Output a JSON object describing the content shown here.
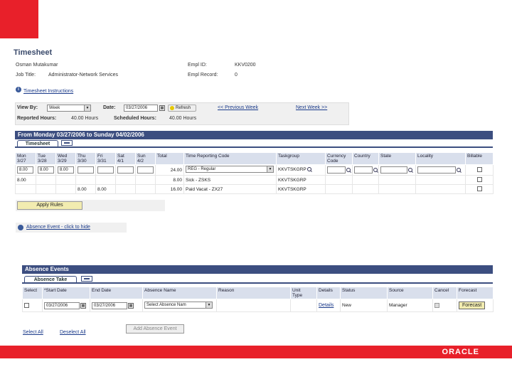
{
  "page": {
    "title": "Timesheet",
    "employee_name": "Osman Mutakumar",
    "job_title_label": "Job Title:",
    "job_title_value": "Administrator-Network Services",
    "empl_id_label": "Empl ID:",
    "empl_id_value": "KKV0200",
    "empl_rcd_label": "Empl Record:",
    "empl_rcd_value": "0",
    "instructions_link": "Timesheet Instructions"
  },
  "filters": {
    "view_by_label": "View By:",
    "view_by_value": "Week",
    "date_label": "Date:",
    "date_value": "03/27/2006",
    "refresh_label": "Refresh",
    "prev_week": "<< Previous Week",
    "next_week": "Next Week >>",
    "reported_label": "Reported Hours:",
    "reported_value": "40.00 Hours",
    "scheduled_label": "Scheduled Hours:",
    "scheduled_value": "40.00 Hours"
  },
  "timesheet": {
    "range_title": "From Monday 03/27/2006 to Sunday 04/02/2006",
    "tab_label": "Timesheet",
    "headers": [
      [
        "Mon",
        "3/27"
      ],
      [
        "Tue",
        "3/28"
      ],
      [
        "Wed",
        "3/29"
      ],
      [
        "Thu",
        "3/30"
      ],
      [
        "Fri",
        "3/31"
      ],
      [
        "Sat",
        "4/1"
      ],
      [
        "Sun",
        "4/2"
      ],
      [
        "Total",
        ""
      ],
      [
        "Time Reporting Code",
        ""
      ],
      [
        "Taskgroup",
        ""
      ],
      [
        "Currency",
        "Code"
      ],
      [
        "Country",
        ""
      ],
      [
        "State",
        ""
      ],
      [
        "Locality",
        ""
      ],
      [
        "Billable",
        ""
      ]
    ],
    "rows": [
      {
        "days": [
          "8.00",
          "8.00",
          "8.00",
          "",
          "",
          "",
          ""
        ],
        "total": "24.00",
        "trc": "REG - Regular",
        "taskgroup": "KKVTSKGRP"
      },
      {
        "days": [
          "8.00",
          "",
          "",
          "",
          "",
          "",
          ""
        ],
        "total": "8.00",
        "trc": "Sick - ZSKS",
        "taskgroup": "KKVTSKGRP"
      },
      {
        "days": [
          "",
          "",
          "",
          "8.00",
          "8.00",
          "",
          ""
        ],
        "total": "16.00",
        "trc": "Paid Vacat - ZX27",
        "taskgroup": "KKVTSKGRP"
      }
    ],
    "apply_label": "Apply Rules"
  },
  "absence": {
    "toggle_link": "Absence Event - click to hide",
    "bar_title": "Absence Events",
    "tab_label": "Absence Take",
    "headers": [
      [
        "Select",
        ""
      ],
      [
        "*Start Date",
        ""
      ],
      [
        "End Date",
        ""
      ],
      [
        "Absence Name",
        ""
      ],
      [
        "Reason",
        ""
      ],
      [
        "Unit",
        "Type"
      ],
      [
        "Details",
        ""
      ],
      [
        "Status",
        ""
      ],
      [
        "Source",
        ""
      ],
      [
        "Cancel",
        ""
      ],
      [
        "Forecast",
        ""
      ]
    ],
    "row": {
      "start_date": "03/27/2006",
      "end_date": "03/27/2006",
      "absence_name": "Select Absence Nam",
      "details_link": "Details",
      "status": "New",
      "source": "Manager",
      "forecast_label": "Forecast"
    },
    "select_all": "Select All",
    "deselect_all": "Deselect All",
    "add_event": "Add Absence Event"
  },
  "brand": {
    "logo_text": "ORACLE",
    "accent": "#e8202a",
    "bar_color": "#3c4e80"
  }
}
